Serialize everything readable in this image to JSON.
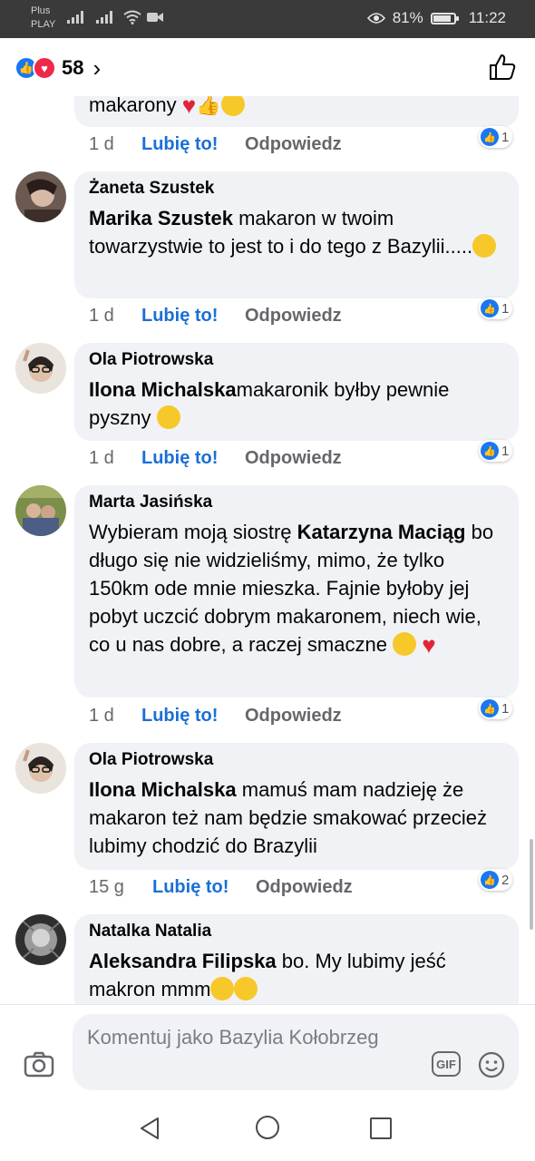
{
  "status_bar": {
    "carrier_top": "Plus",
    "carrier_bottom": "PLAY",
    "battery": "81%",
    "time": "11:22"
  },
  "header": {
    "reaction_count": "58",
    "reaction_icons": [
      "like-icon",
      "love-icon"
    ]
  },
  "comments": [
    {
      "author": "",
      "body_plain": "makarony",
      "time": "1 d",
      "like_label": "Lubię to!",
      "reply_label": "Odpowiedz",
      "reactions": "1"
    },
    {
      "author": "Żaneta Szustek",
      "mention": "Marika Szustek",
      "body_plain": " makaron w twoim towarzystwie to jest to i do tego  z Bazylii.....",
      "time": "1 d",
      "like_label": "Lubię to!",
      "reply_label": "Odpowiedz",
      "reactions": "1"
    },
    {
      "author": "Ola Piotrowska",
      "mention": "Ilona Michalska",
      "body_plain": "makaronik byłby pewnie pyszny",
      "time": "1 d",
      "like_label": "Lubię to!",
      "reply_label": "Odpowiedz",
      "reactions": "1"
    },
    {
      "author": "Marta Jasińska",
      "body_pre": "Wybieram moją siostrę ",
      "mention": "Katarzyna Maciąg",
      "body_plain": " bo długo się nie widzieliśmy, mimo, że tylko 150km ode mnie mieszka. Fajnie byłoby jej pobyt uczcić dobrym makaronem, niech wie, co u nas dobre, a raczej smaczne",
      "time": "1 d",
      "like_label": "Lubię to!",
      "reply_label": "Odpowiedz",
      "reactions": "1"
    },
    {
      "author": "Ola Piotrowska",
      "mention": "Ilona Michalska",
      "body_plain": "  mamuś mam nadzieję że makaron też nam będzie smakować przecież lubimy chodzić do Brazylii",
      "time": "15 g",
      "like_label": "Lubię to!",
      "reply_label": "Odpowiedz",
      "reactions": "2"
    },
    {
      "author": "Natalka Natalia",
      "mention": "Aleksandra Filipska",
      "body_plain": " bo. My lubimy jeść makron mmm"
    }
  ],
  "composer": {
    "placeholder": "Komentuj jako Bazylia Kołobrzeg",
    "gif_label": "GIF"
  },
  "colors": {
    "accent": "#1a6fd6",
    "bubble": "#f0f2f5",
    "like": "#1877f2",
    "love": "#f0284a"
  }
}
